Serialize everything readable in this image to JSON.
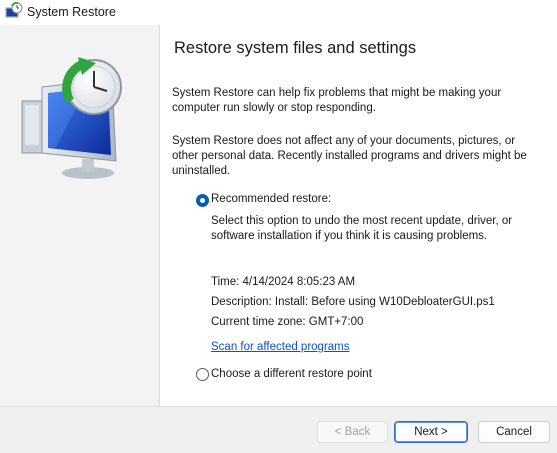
{
  "window": {
    "title": "System Restore",
    "icon": "system-restore-icon"
  },
  "main": {
    "heading": "Restore system files and settings",
    "intro": "System Restore can help fix problems that might be making your computer run slowly or stop responding.",
    "note": "System Restore does not affect any of your documents, pictures, or other personal data. Recently installed programs and drivers might be uninstalled.",
    "recommended": {
      "label": "Recommended restore:",
      "selected": true,
      "description": "Select this option to undo the most recent update, driver, or software installation if you think it is causing problems.",
      "time": "Time: 4/14/2024 8:05:23 AM",
      "descr_line": "Description: Install: Before using W10DebloaterGUI.ps1",
      "timezone": "Current time zone: GMT+7:00",
      "scan_link": "Scan for affected programs"
    },
    "different": {
      "label": "Choose a different restore point",
      "selected": false
    }
  },
  "footer": {
    "back": "< Back",
    "next": "Next >",
    "cancel": "Cancel"
  },
  "colors": {
    "accent": "#005fb8",
    "link": "#0a55c6",
    "sidepanel": "#f3f3f3"
  }
}
